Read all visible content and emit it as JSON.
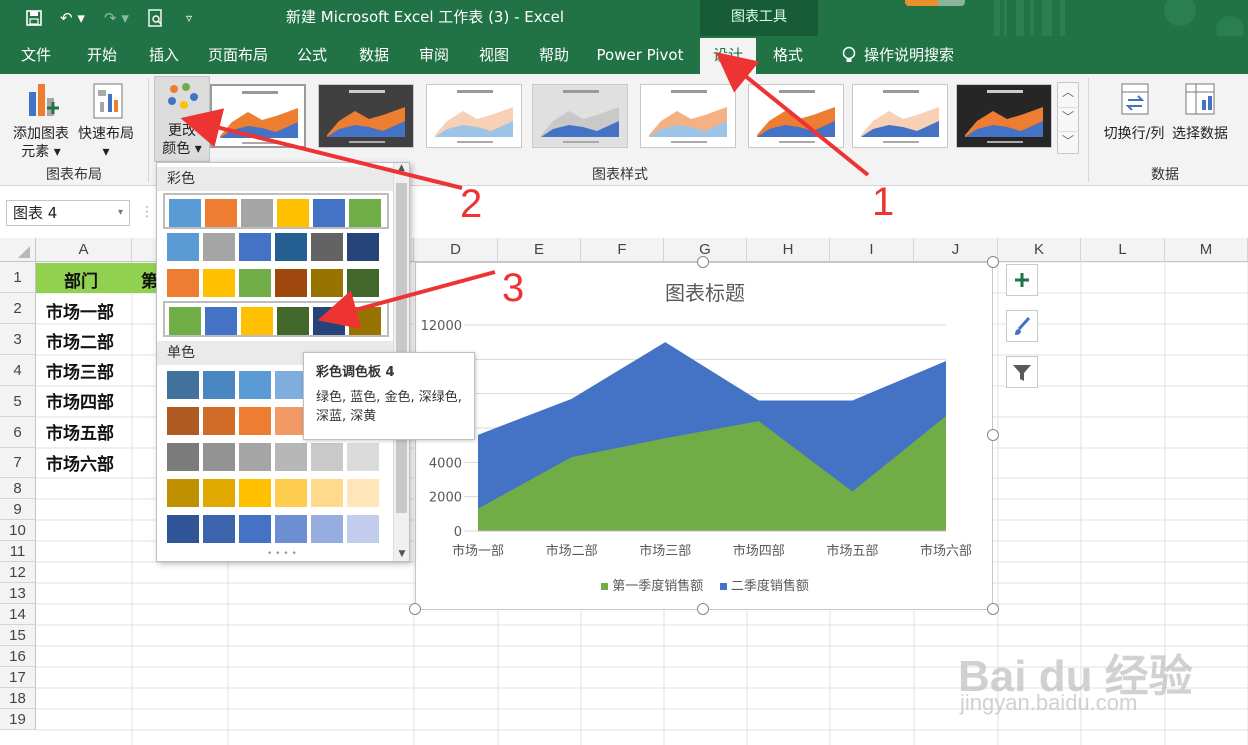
{
  "window": {
    "title": "新建 Microsoft Excel 工作表 (3)  -  Excel",
    "context_tab_group": "图表工具"
  },
  "menu": {
    "tabs": [
      "文件",
      "开始",
      "插入",
      "页面布局",
      "公式",
      "数据",
      "审阅",
      "视图",
      "帮助",
      "Power Pivot",
      "设计",
      "格式"
    ],
    "active_tab": "设计",
    "tell_me": "操作说明搜索"
  },
  "ribbon": {
    "add_element_line1": "添加图表",
    "add_element_line2": "元素",
    "quick_layout": "快速布局",
    "change_colors_line1": "更改",
    "change_colors_line2": "颜色",
    "group_layout": "图表布局",
    "group_styles": "图表样式",
    "switch_row_col": "切换行/列",
    "select_data": "选择数据",
    "group_data": "数据"
  },
  "namebox": {
    "value": "图表 4"
  },
  "sheet": {
    "columns": [
      "A",
      "B",
      "C",
      "D",
      "E",
      "F",
      "G",
      "H",
      "I",
      "J",
      "K",
      "L",
      "M"
    ],
    "rows": [
      "1",
      "2",
      "3",
      "4",
      "5",
      "6",
      "7",
      "8",
      "9",
      "10",
      "11",
      "12",
      "13",
      "14",
      "15",
      "16",
      "17",
      "18",
      "19"
    ],
    "header_a1": "部门",
    "header_b1_partial": "第",
    "departments": [
      "市场一部",
      "市场二部",
      "市场三部",
      "市场四部",
      "市场五部",
      "市场六部"
    ]
  },
  "color_dropdown": {
    "section_colorful": "彩色",
    "section_mono": "单色",
    "colorful_rows": [
      [
        "#5b9bd5",
        "#ed7d31",
        "#a5a5a5",
        "#ffc000",
        "#4472c4",
        "#70ad47"
      ],
      [
        "#5b9bd5",
        "#a5a5a5",
        "#4472c4",
        "#255e91",
        "#636363",
        "#264478"
      ],
      [
        "#ed7d31",
        "#ffc000",
        "#70ad47",
        "#9e480e",
        "#997300",
        "#43682b"
      ],
      [
        "#70ad47",
        "#4472c4",
        "#ffc000",
        "#43682b",
        "#264478",
        "#997300"
      ]
    ],
    "mono_rows": [
      [
        "#41719c",
        "#4a87c0",
        "#5b9bd5",
        "#7faedd",
        "#a3c4e8",
        "#c5d9f0"
      ],
      [
        "#ae5a21",
        "#d06b28",
        "#ed7d31",
        "#f19a66",
        "#f5b894",
        "#f9d5c0"
      ],
      [
        "#7b7b7b",
        "#939393",
        "#a5a5a5",
        "#b7b7b7",
        "#c9c9c9",
        "#dbdbdb"
      ],
      [
        "#bf9000",
        "#e0a800",
        "#ffc000",
        "#ffcd4d",
        "#ffd98c",
        "#ffe5b8"
      ],
      [
        "#2f5597",
        "#3b64ad",
        "#4472c4",
        "#6d8fd1",
        "#98addf",
        "#c2cdee"
      ]
    ]
  },
  "tooltip": {
    "title": "彩色调色板 4",
    "body": "绿色, 蓝色, 金色, 深绿色, 深蓝, 深黄"
  },
  "chart_data": {
    "type": "area",
    "title": "图表标题",
    "categories": [
      "市场一部",
      "市场二部",
      "市场三部",
      "市场四部",
      "市场五部",
      "市场六部"
    ],
    "series": [
      {
        "name": "第一季度销售额",
        "values": [
          1300,
          4300,
          5400,
          6400,
          2300,
          6700
        ],
        "color": "#70ad47"
      },
      {
        "name": "二季度销售额",
        "values": [
          5600,
          7700,
          11000,
          7600,
          7600,
          9900
        ],
        "color": "#4472c4"
      }
    ],
    "ylim": [
      0,
      12000
    ],
    "yticks_visible": [
      "0",
      "2000",
      "4000",
      "12000"
    ],
    "grid": true,
    "legend": "bottom"
  },
  "annotations": [
    "1",
    "2",
    "3"
  ],
  "watermark": {
    "brand": "Bai du 经验",
    "url": "jingyan.baidu.com"
  }
}
